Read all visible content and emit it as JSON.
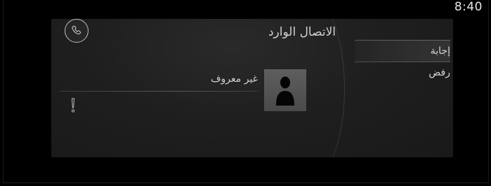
{
  "status_bar": {
    "time": "8:40"
  },
  "call": {
    "title": "الاتصال الوارد",
    "caller_name": "غير معروف",
    "actions": [
      {
        "label": "إجابة",
        "selected": true
      },
      {
        "label": "رفض",
        "selected": false
      }
    ]
  },
  "icons": {
    "call_button": "phone-icon",
    "avatar": "person-silhouette-icon",
    "warning": "exclamation-icon"
  },
  "colors": {
    "background": "#000000",
    "panel": "#1f1f1f",
    "text": "#d4d4d4"
  }
}
